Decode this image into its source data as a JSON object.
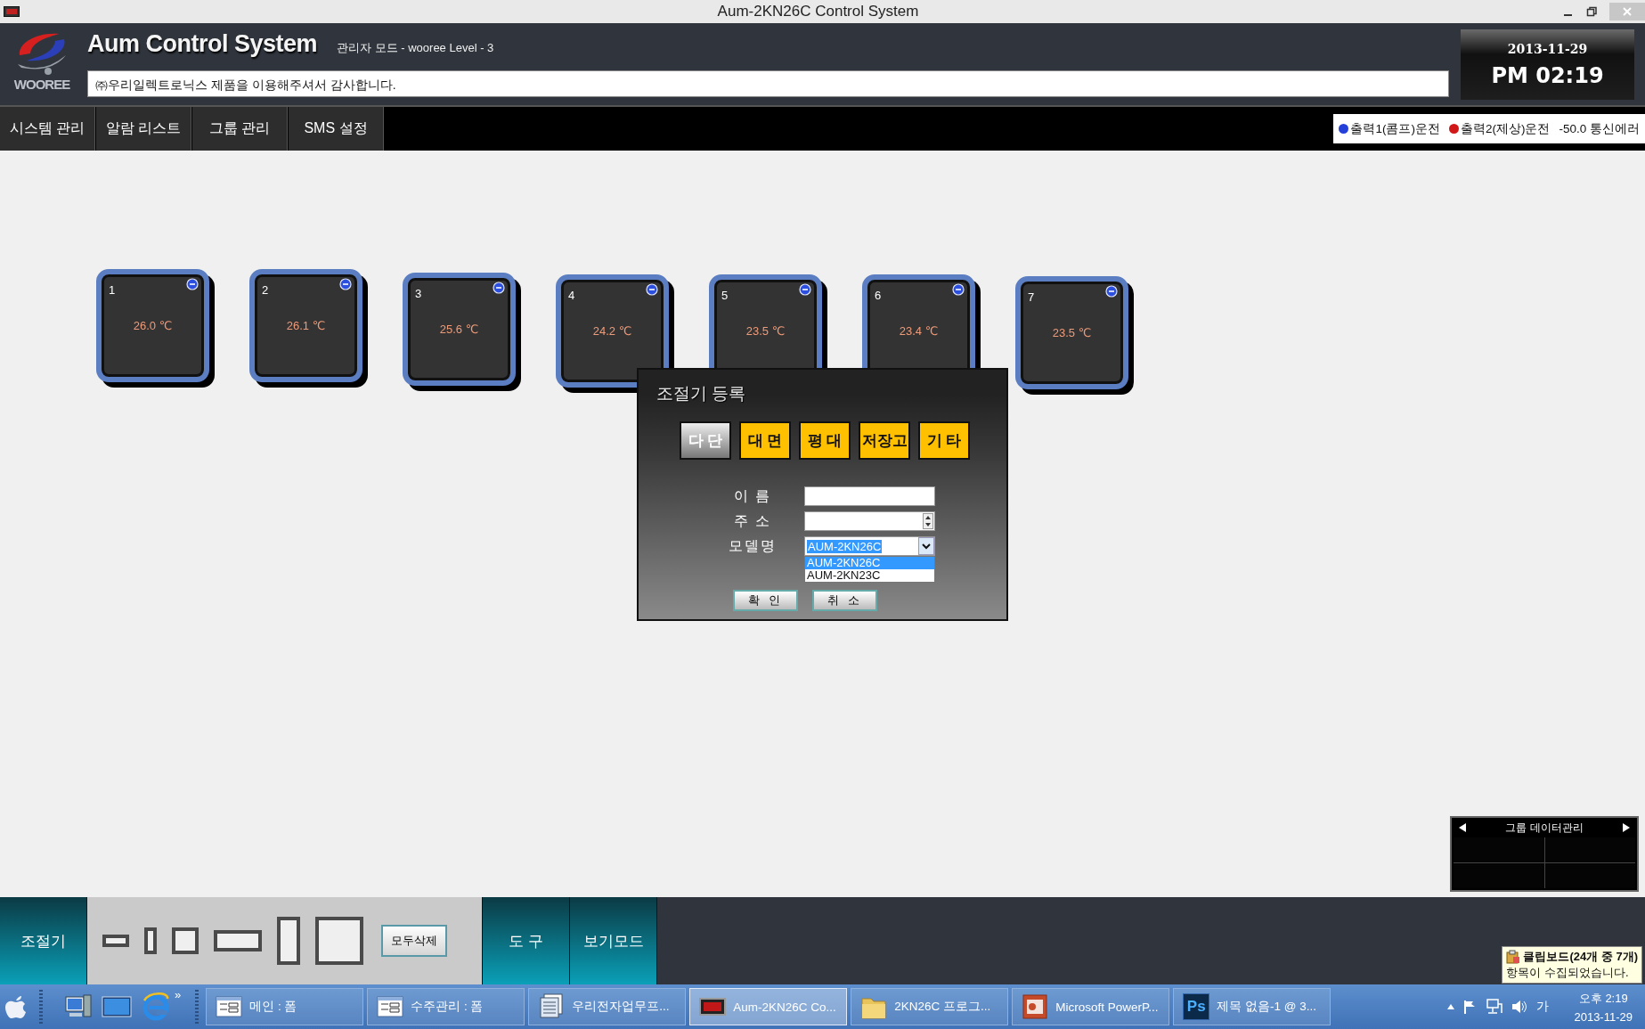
{
  "window": {
    "title": "Aum-2KN26C Control System"
  },
  "header": {
    "logo_text": "WOOREE",
    "app_title": "Aum Control System",
    "mode": "관리자 모드 - wooree  Level - 3",
    "notice": "㈜우리일렉트로닉스 제품을 이용해주셔서 감사합니다.",
    "date": "2013-11-29",
    "time": "PM 02:19"
  },
  "nav_tabs": [
    "시스템 관리",
    "알람 리스트",
    "그룹 관리",
    "SMS 설정"
  ],
  "legend": [
    {
      "kind": "dot",
      "label": "출력1(콤프)운전",
      "color": "#2440d8"
    },
    {
      "kind": "dot",
      "label": "출력2(제상)운전",
      "color": "#d01818"
    },
    {
      "kind": "text",
      "label": "-50.0 통신에러"
    }
  ],
  "controllers": [
    {
      "number": "1",
      "temperature": "26.0 ℃"
    },
    {
      "number": "2",
      "temperature": "26.1 ℃"
    },
    {
      "number": "3",
      "temperature": "25.6 ℃"
    },
    {
      "number": "4",
      "temperature": "24.2 ℃"
    },
    {
      "number": "5",
      "temperature": "23.5 ℃"
    },
    {
      "number": "6",
      "temperature": "23.4 ℃"
    },
    {
      "number": "7",
      "temperature": "23.5 ℃"
    }
  ],
  "dialog": {
    "title": "조절기 등록",
    "types": [
      {
        "label": "다 단",
        "selected": true
      },
      {
        "label": "대 면",
        "selected": false
      },
      {
        "label": "평 대",
        "selected": false
      },
      {
        "label": "저장고",
        "selected": false
      },
      {
        "label": "기 타",
        "selected": false
      }
    ],
    "fields": [
      {
        "kind": "text",
        "label": "이 름"
      },
      {
        "kind": "spinner",
        "label": "주 소"
      },
      {
        "kind": "combo",
        "label": "모델명",
        "value": "AUM-2KN26C",
        "options": [
          {
            "label": "AUM-2KN26C",
            "selected": true
          },
          {
            "label": "AUM-2KN23C",
            "selected": false
          }
        ]
      }
    ],
    "buttons": [
      "확 인",
      "취 소"
    ]
  },
  "group_panel": {
    "title": "그룹 데이터관리"
  },
  "toolbar": {
    "tabs": [
      "조절기",
      "도 구",
      "보기모드"
    ],
    "clear_button": "모두삭제"
  },
  "clipboard_tip": {
    "title": "클립보드(24개 중 7개)",
    "text": "항목이 수집되었습니다."
  },
  "taskbar": {
    "overflow": "»",
    "items": [
      {
        "kind": "form",
        "label": "메인 : 폼",
        "selected": false
      },
      {
        "kind": "form",
        "label": "수주관리 : 폼",
        "selected": false
      },
      {
        "kind": "docs",
        "label": "우리전자업무프...",
        "selected": false
      },
      {
        "kind": "temp",
        "label": "Aum-2KN26C Co...",
        "selected": true
      },
      {
        "kind": "folder",
        "label": "2KN26C 프로그...",
        "selected": false
      },
      {
        "kind": "ppt",
        "label": "Microsoft PowerP...",
        "selected": false
      },
      {
        "kind": "ps",
        "icon_text": "Ps",
        "label": "제목 없음-1 @ 3...",
        "selected": false
      }
    ],
    "ime": "가",
    "clock_time": "오후 2:19",
    "clock_date": "2013-11-29"
  }
}
